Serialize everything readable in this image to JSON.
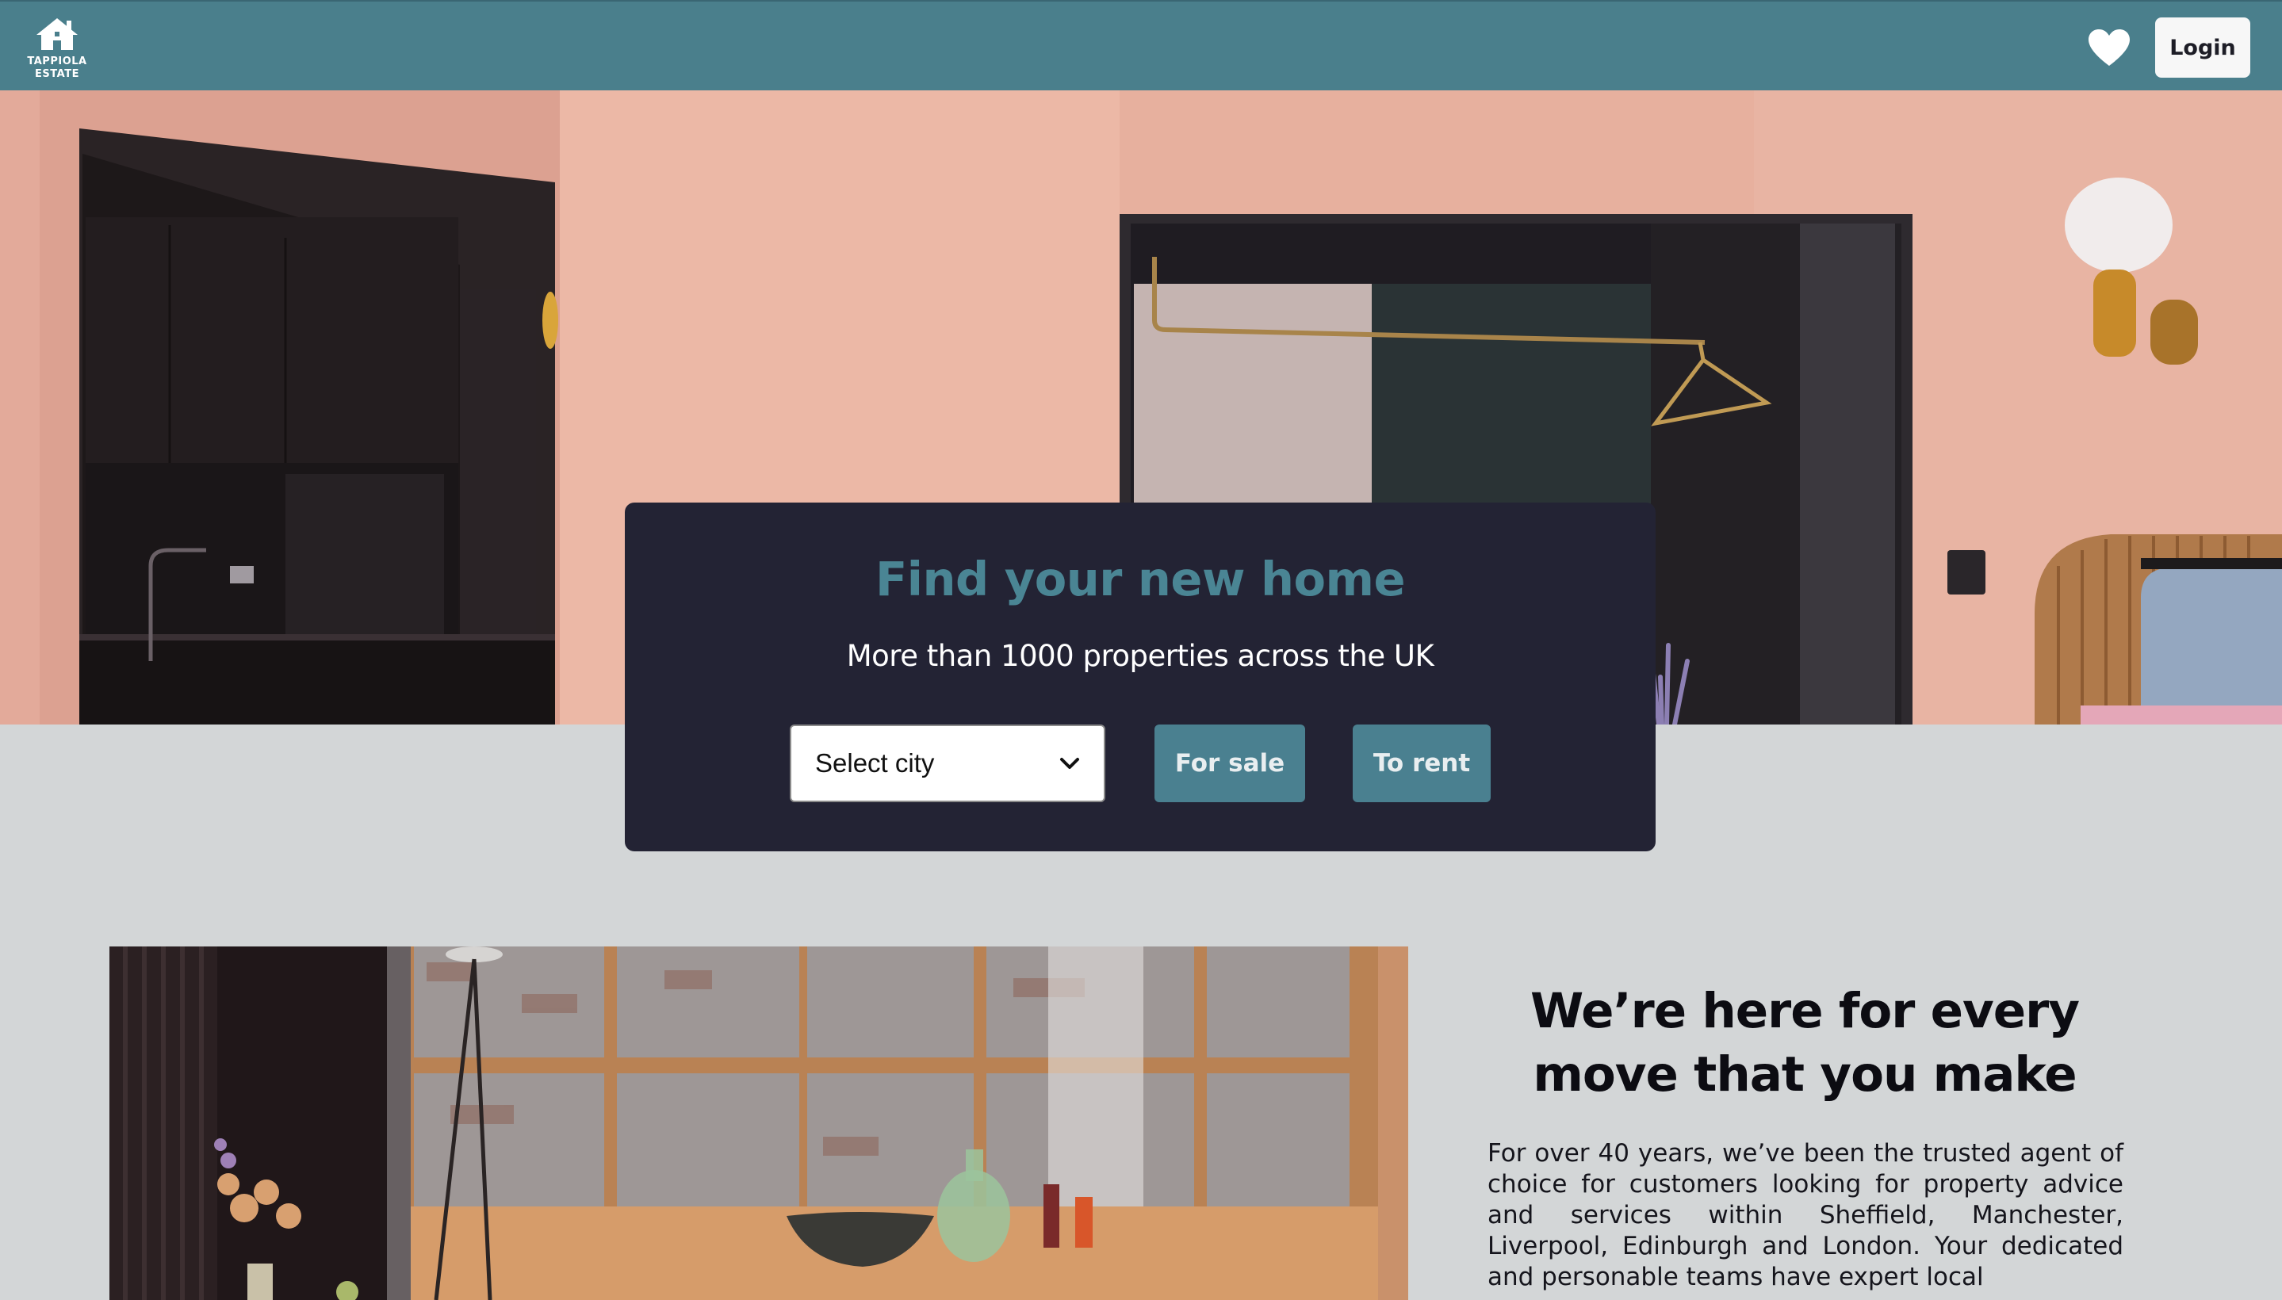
{
  "header": {
    "logo_text": "TAPPIOLA ESTATE",
    "logo_icon": "house-icon",
    "favorites_icon": "heart-icon",
    "login_label": "Login"
  },
  "search": {
    "title": "Find your new home",
    "subtitle": "More than 1000 properties across the UK",
    "city_select": {
      "selected": "Select city"
    },
    "for_sale_label": "For sale",
    "to_rent_label": "To rent"
  },
  "about": {
    "heading": "We’re here for every move that you make",
    "body": "For over 40 years, we’ve been the trusted agent of choice for customers looking for property advice and services within Sheffield, Manchester, Liverpool, Edinburgh and London. Your dedicated and personable teams have expert local"
  },
  "colors": {
    "header_bg": "#4a7f8c",
    "panel_bg": "#232334",
    "accent": "#4a8594",
    "page_bg": "#d3d6d7",
    "wall_pink": "#e6b3a4"
  }
}
